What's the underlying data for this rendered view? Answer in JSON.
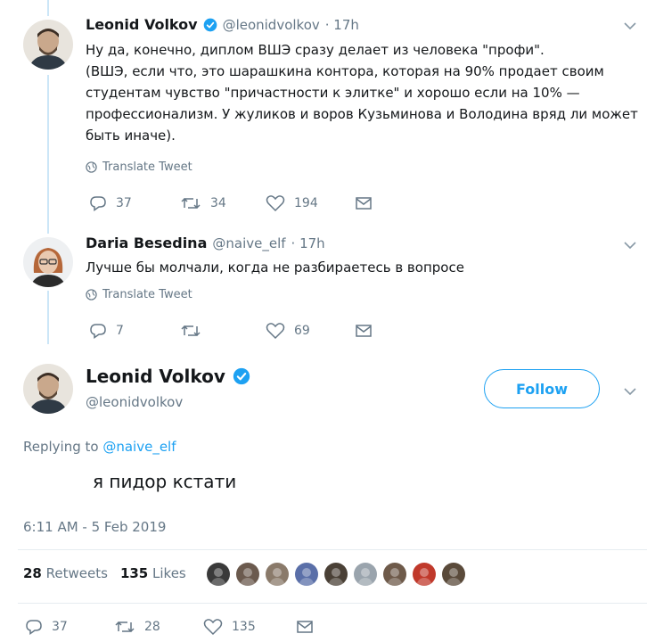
{
  "tweet1": {
    "name": "Leonid Volkov",
    "handle": "@leonidvolkov",
    "time": "· 17h",
    "lines": [
      "Ну да, конечно, диплом ВШЭ сразу делает из человека \"профи\".",
      "(ВШЭ, если что, это шарашкина контора, которая на 90% продает своим",
      "студентам чувство \"причастности к элитке\" и хорошо если на 10% —",
      "профессионализм. У жуликов и воров Кузьминова и Володина вряд ли может",
      "быть иначе)."
    ],
    "translate": "Translate Tweet",
    "replies": "37",
    "retweets": "34",
    "likes": "194"
  },
  "tweet2": {
    "name": "Daria Besedina",
    "handle": "@naive_elf",
    "time": "· 17h",
    "text": "Лучше бы молчали, когда не разбираетесь в вопросе",
    "translate": "Translate Tweet",
    "replies": "7",
    "likes": "69"
  },
  "main": {
    "name": "Leonid Volkov",
    "handle": "@leonidvolkov",
    "follow_label": "Follow",
    "replying_prefix": "Replying to",
    "replying_handle": "@naive_elf",
    "text": "я пидор кстати",
    "timestamp": "6:11 AM - 5 Feb 2019",
    "retweets_count": "28",
    "retweets_label": "Retweets",
    "likes_count": "135",
    "likes_label": "Likes",
    "likers": [
      "#3a3a3a",
      "#6b5a4e",
      "#8a7a6a",
      "#5a6fa8",
      "#4a4036",
      "#9aa4ad",
      "#6e5a4a",
      "#c0392b",
      "#5a4a3a"
    ],
    "replies": "37",
    "retweets": "28",
    "likes": "135"
  }
}
